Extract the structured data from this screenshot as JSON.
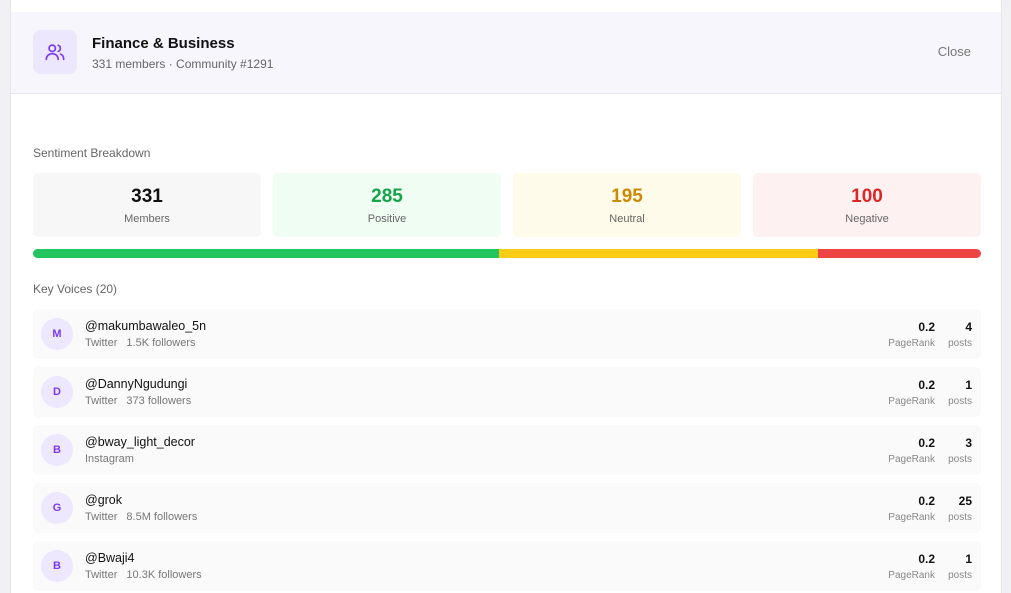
{
  "header": {
    "title": "Finance & Business",
    "subtitle": "331 members · Community #1291",
    "close_label": "Close",
    "icon": "users-icon"
  },
  "sentiment": {
    "section_label": "Sentiment Breakdown",
    "stats": [
      {
        "key": "members",
        "value": "331",
        "label": "Members",
        "color": "#111111",
        "bg": "#f7f7f7"
      },
      {
        "key": "positive",
        "value": "285",
        "label": "Positive",
        "color": "#16a34a",
        "bg": "#effdf3"
      },
      {
        "key": "neutral",
        "value": "195",
        "label": "Neutral",
        "color": "#ca8a04",
        "bg": "#fefbea"
      },
      {
        "key": "negative",
        "value": "100",
        "label": "Negative",
        "color": "#dc2626",
        "bg": "#fef1f1"
      }
    ],
    "bar": [
      {
        "key": "positive",
        "fraction": 0.492,
        "color": "#22c55e"
      },
      {
        "key": "neutral",
        "fraction": 0.336,
        "color": "#facc15"
      },
      {
        "key": "negative",
        "fraction": 0.172,
        "color": "#ef4444"
      }
    ]
  },
  "voices": {
    "section_label": "Key Voices (20)",
    "pagerank_label": "PageRank",
    "posts_label": "posts",
    "items": [
      {
        "initial": "M",
        "handle": "@makumbawaleo_5n",
        "platform": "Twitter",
        "followers": "1.5K followers",
        "pagerank": "0.2",
        "posts": "4"
      },
      {
        "initial": "D",
        "handle": "@DannyNgudungi",
        "platform": "Twitter",
        "followers": "373 followers",
        "pagerank": "0.2",
        "posts": "1"
      },
      {
        "initial": "B",
        "handle": "@bway_light_decor",
        "platform": "Instagram",
        "followers": "",
        "pagerank": "0.2",
        "posts": "3"
      },
      {
        "initial": "G",
        "handle": "@grok",
        "platform": "Twitter",
        "followers": "8.5M followers",
        "pagerank": "0.2",
        "posts": "25"
      },
      {
        "initial": "B",
        "handle": "@Bwaji4",
        "platform": "Twitter",
        "followers": "10.3K followers",
        "pagerank": "0.2",
        "posts": "1"
      }
    ]
  },
  "colors": {
    "accent": "#7c3aed",
    "accent_bg": "#ede8fd"
  }
}
